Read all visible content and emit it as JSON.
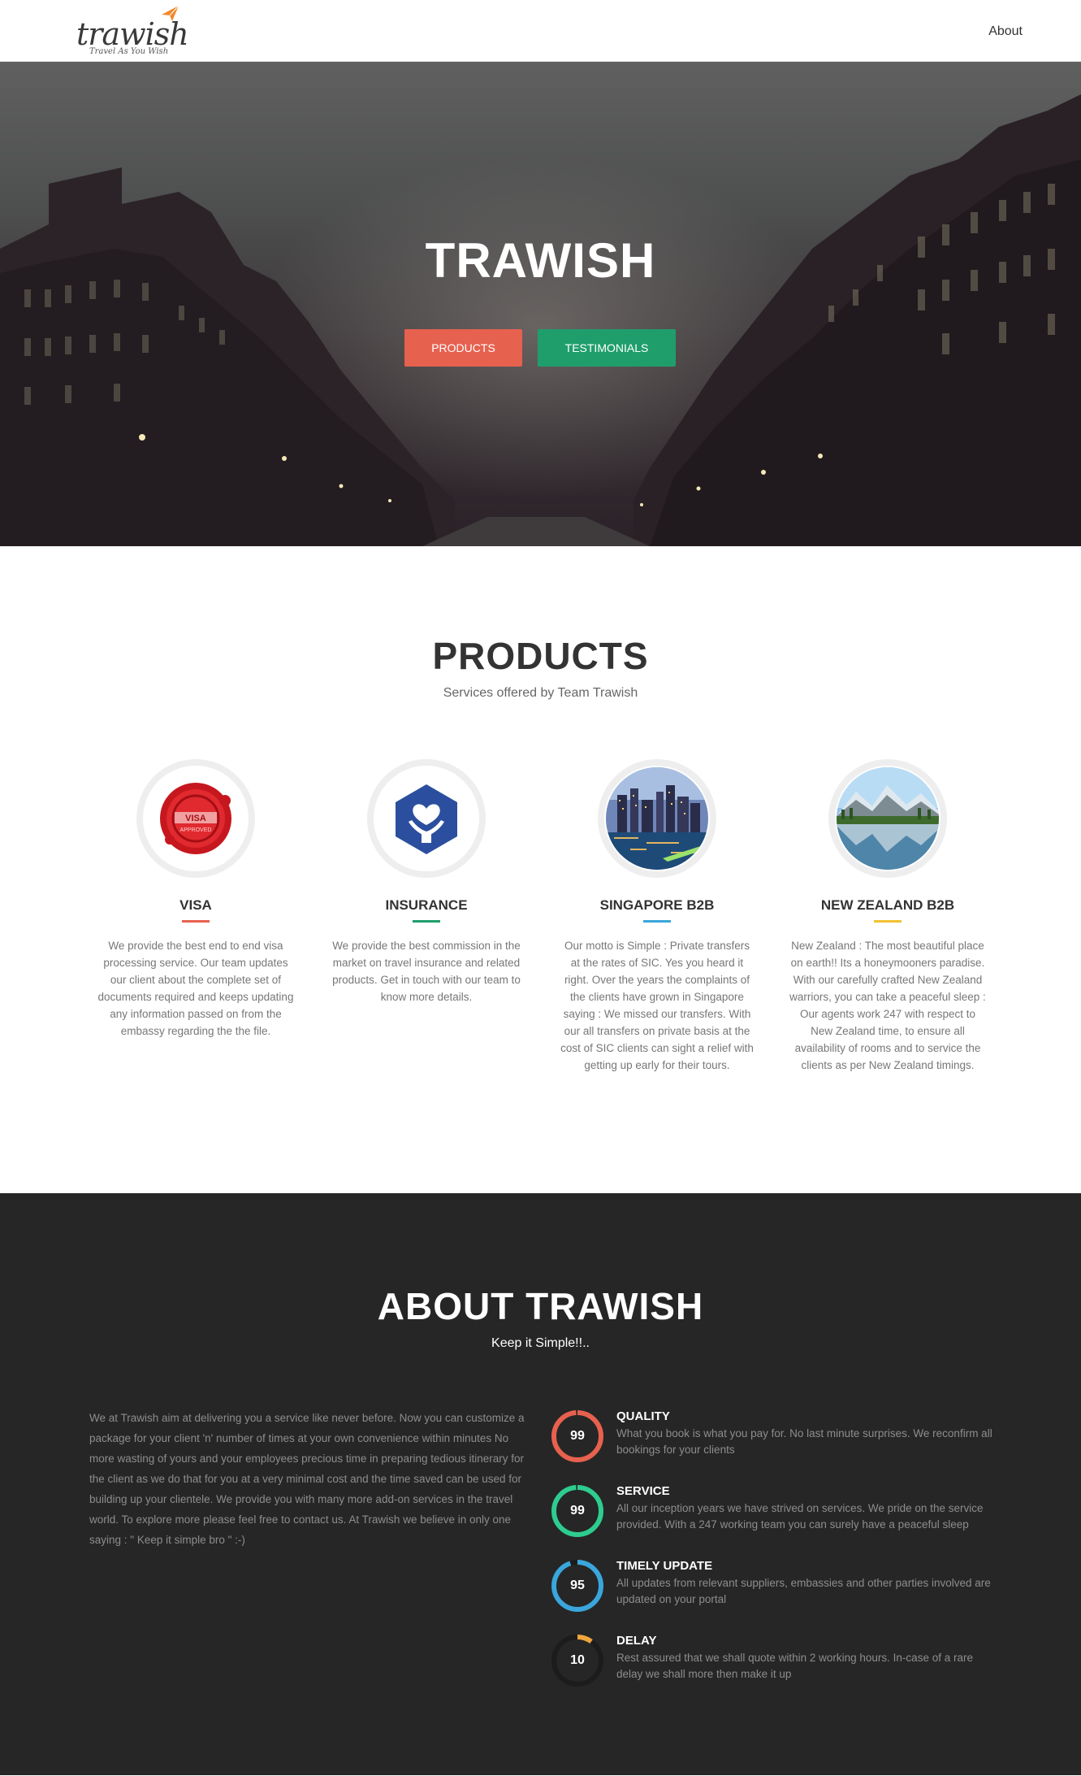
{
  "nav": {
    "logo_word": "trawish",
    "logo_tagline": "Travel As You Wish",
    "about_link": "About"
  },
  "hero": {
    "title": "TRAWISH",
    "products_button": "PRODUCTS",
    "testimonials_button": "TESTIMONIALS"
  },
  "products": {
    "title": "PRODUCTS",
    "subtitle": "Services offered by Team Trawish",
    "items": [
      {
        "name": "VISA",
        "accent": "#e7614f",
        "icon": "visa-approved-seal-icon",
        "seal_text": "VISA",
        "seal_subtext": "APPROVED",
        "description": "We provide the best end to end visa processing service. Our team updates our client about the complete set of documents required and keeps updating any information passed on from the embassy regarding the the file."
      },
      {
        "name": "INSURANCE",
        "accent": "#1f9e6c",
        "icon": "insurance-hands-heart-icon",
        "description": "We provide the best commission in the market on travel insurance and related products. Get in touch with our team to know more details."
      },
      {
        "name": "SINGAPORE B2B",
        "accent": "#3aa6dc",
        "icon": "singapore-skyline-image",
        "description": "Our motto is Simple : Private transfers at the rates of SIC. Yes you heard it right. Over the years the complaints of the clients have grown in Singapore saying : We missed our transfers. With our all transfers on private basis at the cost of SIC clients can sight a relief with getting up early for their tours."
      },
      {
        "name": "NEW ZEALAND B2B",
        "accent": "#f1c232",
        "icon": "new-zealand-lake-image",
        "description": "New Zealand : The most beautiful place on earth!! Its a honeymooners paradise. With our carefully crafted New Zealand warriors, you can take a peaceful sleep : Our agents work 247 with respect to New Zealand time, to ensure all availability of rooms and to service the clients as per New Zealand timings."
      }
    ]
  },
  "about": {
    "title": "ABOUT TRAWISH",
    "subtitle": "Keep it Simple!!..",
    "body": "We at Trawish aim at delivering you a service like never before. Now you can customize a package for your client 'n' number of times at your own convenience within minutes No more wasting of yours and your employees precious time in preparing tedious itinerary for the client as we do that for you at a very minimal cost and the time saved can be used for building up your clientele. We provide you with many more add-on services in the travel world. To explore more please feel free to contact us. At Trawish we believe in only one saying : \" Keep it simple bro \" :-)",
    "skills": [
      {
        "value": "99",
        "percent": 99,
        "color": "#e7614f",
        "title": "QUALITY",
        "description": "What you book is what you pay for. No last minute surprises. We reconfirm all bookings for your clients"
      },
      {
        "value": "99",
        "percent": 99,
        "color": "#2ecc8f",
        "title": "SERVICE",
        "description": "All our inception years we have strived on services. We pride on the service provided. With a 247 working team you can surely have a peaceful sleep"
      },
      {
        "value": "95",
        "percent": 95,
        "color": "#3aa6dc",
        "title": "TIMELY UPDATE",
        "description": "All updates from relevant suppliers, embassies and other parties involved are updated on your portal"
      },
      {
        "value": "10",
        "percent": 10,
        "color": "#f0a63a",
        "title": "DELAY",
        "description": "Rest assured that we shall quote within 2 working hours. In-case of a rare delay we shall more then make it up"
      }
    ]
  }
}
